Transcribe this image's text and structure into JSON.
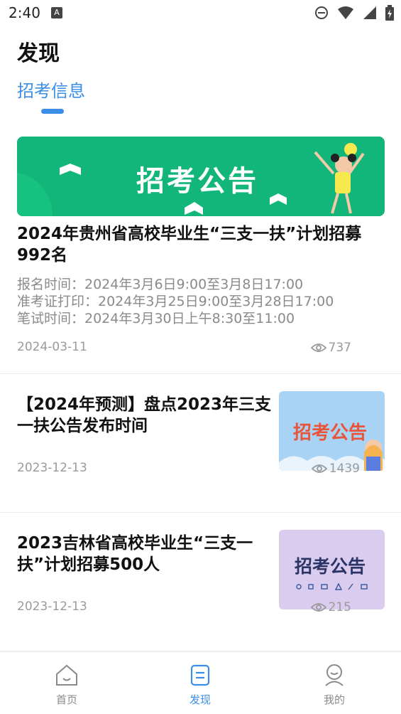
{
  "status_bar": {
    "time": "2:40",
    "notif_icon_letter": "A",
    "icons": [
      "dnd-icon",
      "wifi-icon",
      "signal-icon",
      "battery-icon"
    ]
  },
  "page_title": "发现",
  "tab": {
    "label": "招考信息",
    "color": "#3a8ee6"
  },
  "articles": [
    {
      "banner_text": "招考公告",
      "title": "2024年贵州省高校毕业生“三支一扶”计划招募992名",
      "info": [
        "报名时间：2024年3月6日9:00至3月8日17:00",
        "准考证打印：2024年3月25日9:00至3月28日17:00",
        "笔试时间：2024年3月30日上午8:30至11:00"
      ],
      "date": "2024-03-11",
      "views": "737"
    },
    {
      "title": "【2024年预测】盘点2023年三支一扶公告发布时间",
      "thumb_text": "招考公告",
      "date": "2023-12-13",
      "views": "1439"
    },
    {
      "title": "2023吉林省高校毕业生“三支一扶”计划招募500人",
      "thumb_text": "招考公告",
      "date": "2023-12-13",
      "views": "215"
    }
  ],
  "bottom_nav": [
    {
      "label": "首页",
      "icon": "home-icon",
      "active": false
    },
    {
      "label": "发现",
      "icon": "discover-icon",
      "active": true
    },
    {
      "label": "我的",
      "icon": "profile-icon",
      "active": false
    }
  ],
  "colors": {
    "accent": "#3a8ee6",
    "banner_green": "#12b57a",
    "muted_text": "#9a9a9a"
  }
}
